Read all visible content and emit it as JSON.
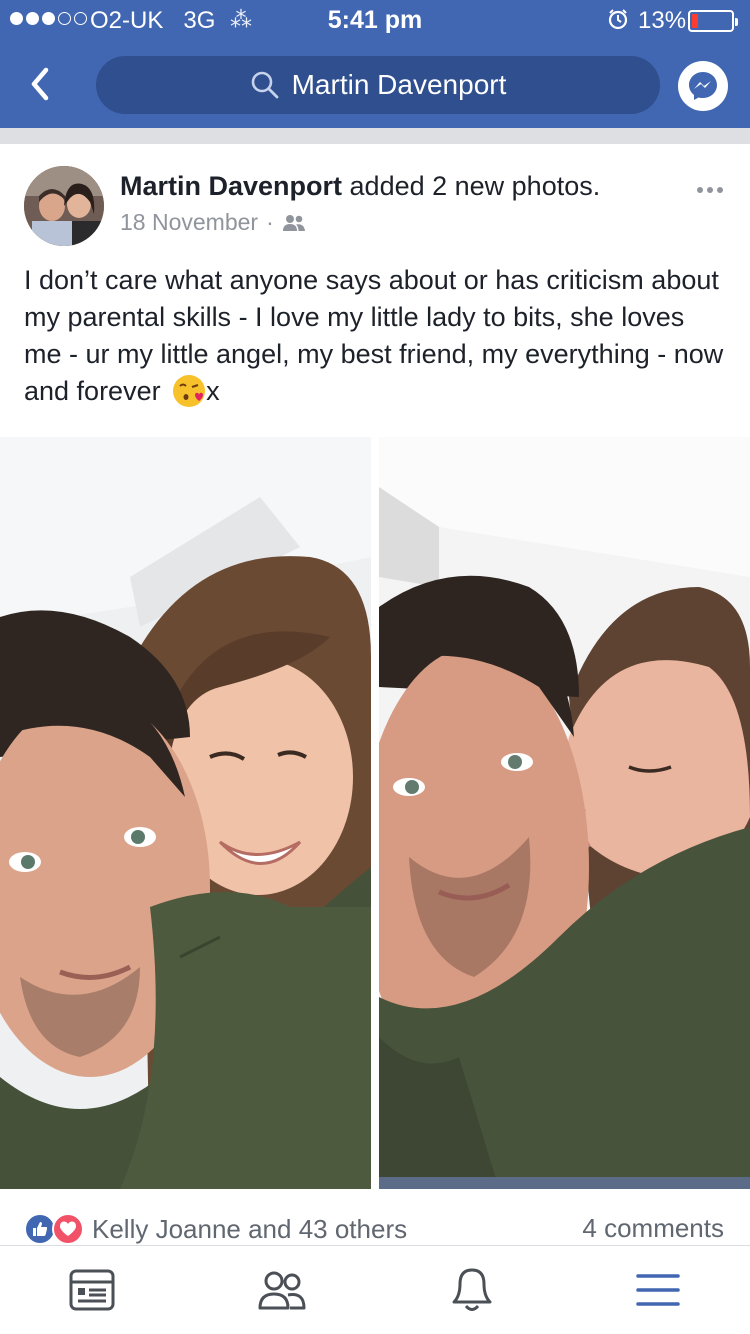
{
  "status_bar": {
    "carrier": "O2-UK",
    "network": "3G",
    "time": "5:41 pm",
    "battery": "13%",
    "battery_level": 0.13,
    "signal_bars": 3,
    "signal_total": 5
  },
  "nav": {
    "search_label": "Martin Davenport",
    "icons": [
      "back-chevron-icon",
      "search-icon",
      "messenger-icon"
    ]
  },
  "post": {
    "author": "Martin Davenport",
    "action": " added 2 new photos.",
    "date": "18 November",
    "separator": "·",
    "audience_icon": "friends-icon",
    "text_main": "I don’t care what anyone says about or has criticism about my parental skills - I love my little lady to bits, she loves me - ur my little angel, my best friend, my everything - now and forever",
    "text_tail": "x",
    "emoji": "face-blowing-kiss"
  },
  "reactions": {
    "summary": "Kelly Joanne and 43 others",
    "comments": "4 comments",
    "types": [
      "like",
      "love"
    ]
  },
  "tabbar": {
    "tabs": [
      {
        "name": "news-feed",
        "icon": "feed-icon"
      },
      {
        "name": "friends",
        "icon": "friends-icon"
      },
      {
        "name": "notifications",
        "icon": "bell-icon"
      },
      {
        "name": "menu",
        "icon": "menu-icon"
      }
    ],
    "accent": "#4267b2"
  },
  "colors": {
    "brand": "#4267b2",
    "text": "#1d2129",
    "meta": "#90949c"
  }
}
